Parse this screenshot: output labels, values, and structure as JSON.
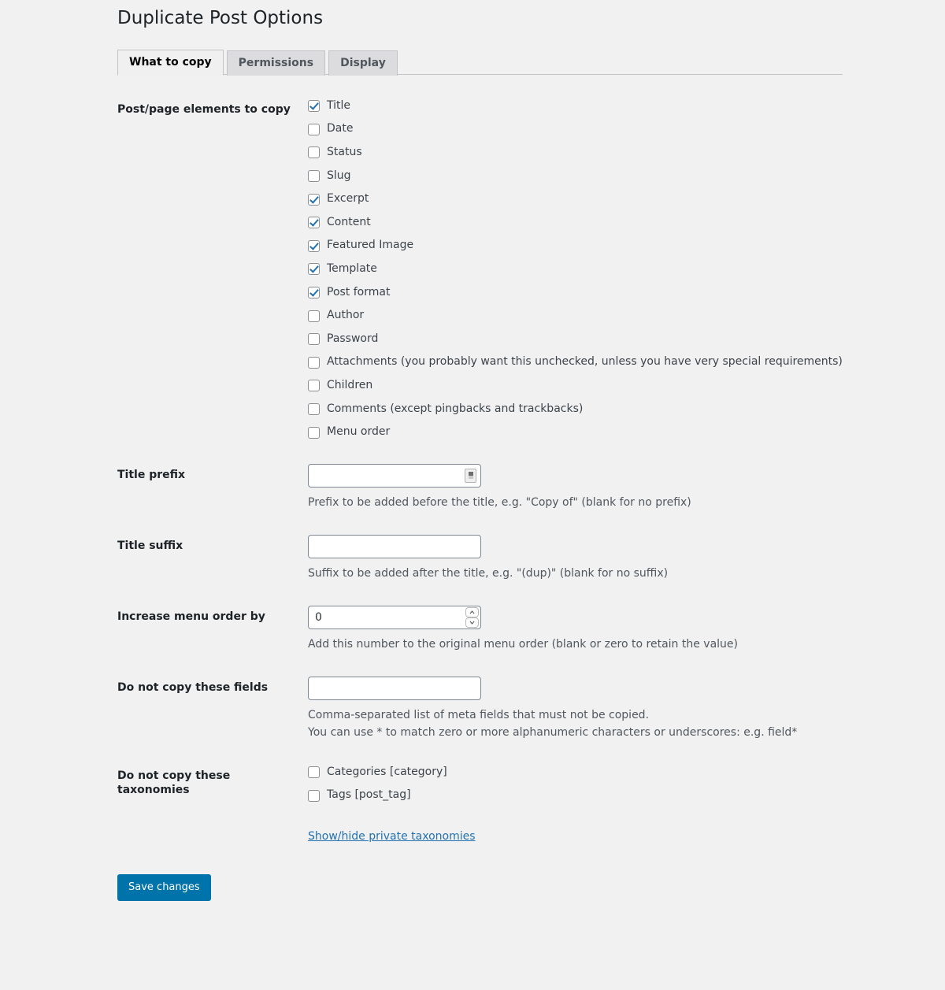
{
  "page": {
    "title": "Duplicate Post Options"
  },
  "tabs": [
    {
      "label": "What to copy",
      "active": true
    },
    {
      "label": "Permissions",
      "active": false
    },
    {
      "label": "Display",
      "active": false
    }
  ],
  "sections": {
    "elements": {
      "label": "Post/page elements to copy",
      "items": [
        {
          "label": "Title",
          "checked": true
        },
        {
          "label": "Date",
          "checked": false
        },
        {
          "label": "Status",
          "checked": false
        },
        {
          "label": "Slug",
          "checked": false
        },
        {
          "label": "Excerpt",
          "checked": true
        },
        {
          "label": "Content",
          "checked": true
        },
        {
          "label": "Featured Image",
          "checked": true
        },
        {
          "label": "Template",
          "checked": true
        },
        {
          "label": "Post format",
          "checked": true
        },
        {
          "label": "Author",
          "checked": false
        },
        {
          "label": "Password",
          "checked": false
        },
        {
          "label": "Attachments (you probably want this unchecked, unless you have very special requirements)",
          "checked": false
        },
        {
          "label": "Children",
          "checked": false
        },
        {
          "label": "Comments (except pingbacks and trackbacks)",
          "checked": false
        },
        {
          "label": "Menu order",
          "checked": false
        }
      ]
    },
    "title_prefix": {
      "label": "Title prefix",
      "value": "",
      "description": "Prefix to be added before the title, e.g. \"Copy of\" (blank for no prefix)"
    },
    "title_suffix": {
      "label": "Title suffix",
      "value": "",
      "description": "Suffix to be added after the title, e.g. \"(dup)\" (blank for no suffix)"
    },
    "menu_order": {
      "label": "Increase menu order by",
      "value": "0",
      "description": "Add this number to the original menu order (blank or zero to retain the value)"
    },
    "do_not_copy_fields": {
      "label": "Do not copy these fields",
      "value": "",
      "description_1": "Comma-separated list of meta fields that must not be copied.",
      "description_2": "You can use * to match zero or more alphanumeric characters or underscores: e.g. field*"
    },
    "do_not_copy_taxonomies": {
      "label": "Do not copy these taxonomies",
      "items": [
        {
          "label": "Categories [category]",
          "checked": false
        },
        {
          "label": "Tags [post_tag]",
          "checked": false
        }
      ],
      "link": "Show/hide private taxonomies"
    }
  },
  "submit": {
    "label": "Save changes"
  },
  "colors": {
    "page_background": "#f1f1f1",
    "accent_blue": "#2271b1",
    "button_blue": "#0073aa",
    "link_blue": "#2271b1",
    "border_grey": "#c3c4c7"
  }
}
